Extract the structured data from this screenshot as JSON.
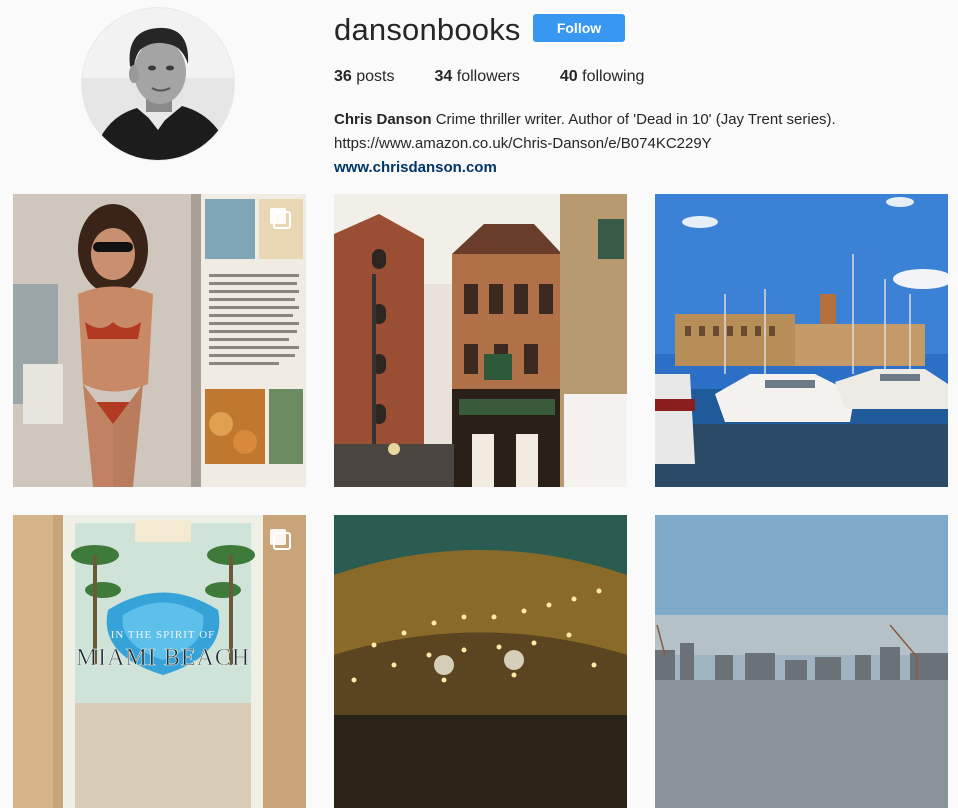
{
  "profile": {
    "username": "dansonbooks",
    "follow_label": "Follow",
    "stats": {
      "posts_count": "36",
      "posts_label": "posts",
      "followers_count": "34",
      "followers_label": "followers",
      "following_count": "40",
      "following_label": "following"
    },
    "bio": {
      "name": "Chris Danson",
      "description": "Crime thriller writer. Author of 'Dead in 10' (Jay Trent series).",
      "link": "https://www.amazon.co.uk/Chris-Danson/e/B074KC229Y",
      "website": "www.chrisdanson.com"
    }
  },
  "colors": {
    "background": "#fafafa",
    "follow_button": "#3897f0",
    "website_link": "#003569"
  },
  "posts": [
    {
      "icon": "carousel-icon",
      "subject": "magazine-bikini-page"
    },
    {
      "subject": "london-pub-street"
    },
    {
      "subject": "marina-with-yachts"
    },
    {
      "icon": "carousel-icon",
      "subject": "miami-beach-book-cover"
    },
    {
      "subject": "string-lights-tent"
    },
    {
      "subject": "city-skyline-haze"
    }
  ],
  "book_cover_text": "IN THE SPIRIT OF MIAMI BEACH"
}
